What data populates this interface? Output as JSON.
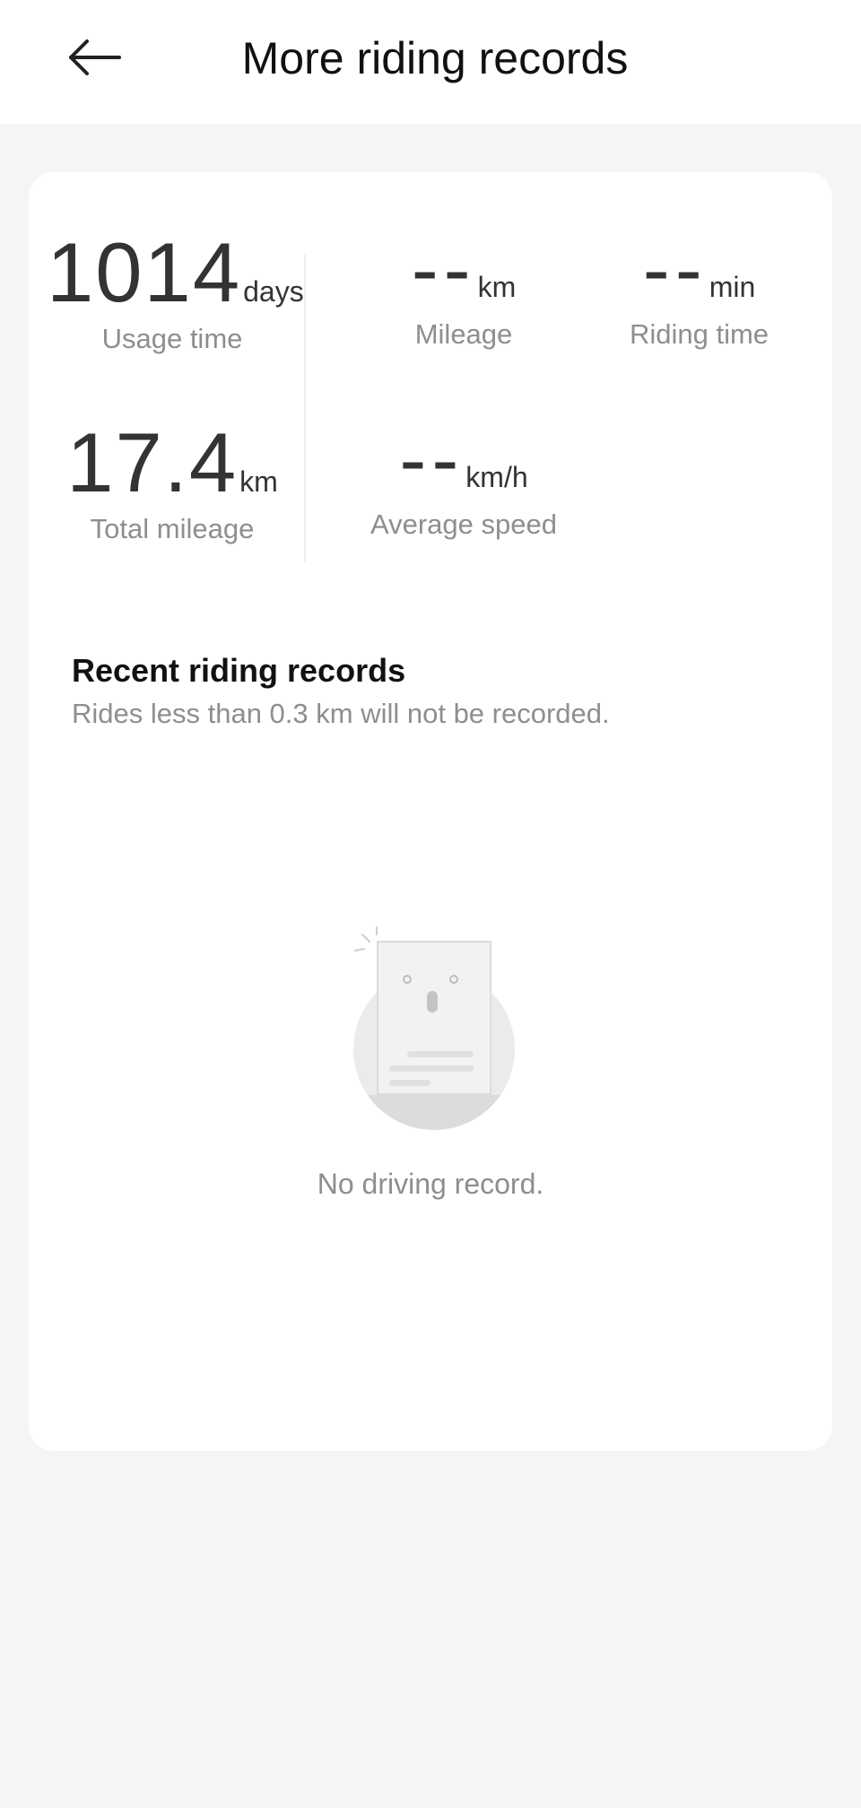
{
  "header": {
    "title": "More riding records",
    "back_icon": "arrow-left-icon"
  },
  "stats": {
    "usage_time": {
      "value": "1014",
      "unit": "days",
      "label": "Usage time"
    },
    "mileage": {
      "value": "--",
      "unit": "km",
      "label": "Mileage"
    },
    "riding_time": {
      "value": "--",
      "unit": "min",
      "label": "Riding time"
    },
    "total_mileage": {
      "value": "17.4",
      "unit": "km",
      "label": "Total mileage"
    },
    "average_speed": {
      "value": "--",
      "unit": "km/h",
      "label": "Average speed"
    }
  },
  "recent": {
    "title": "Recent riding records",
    "subtitle": "Rides less than 0.3 km will not be recorded.",
    "empty_icon": "empty-document-icon",
    "empty_text": "No driving record."
  },
  "colors": {
    "background": "#f5f5f5",
    "card": "#ffffff",
    "text_primary": "#333333",
    "text_secondary": "#8e8e8e"
  }
}
